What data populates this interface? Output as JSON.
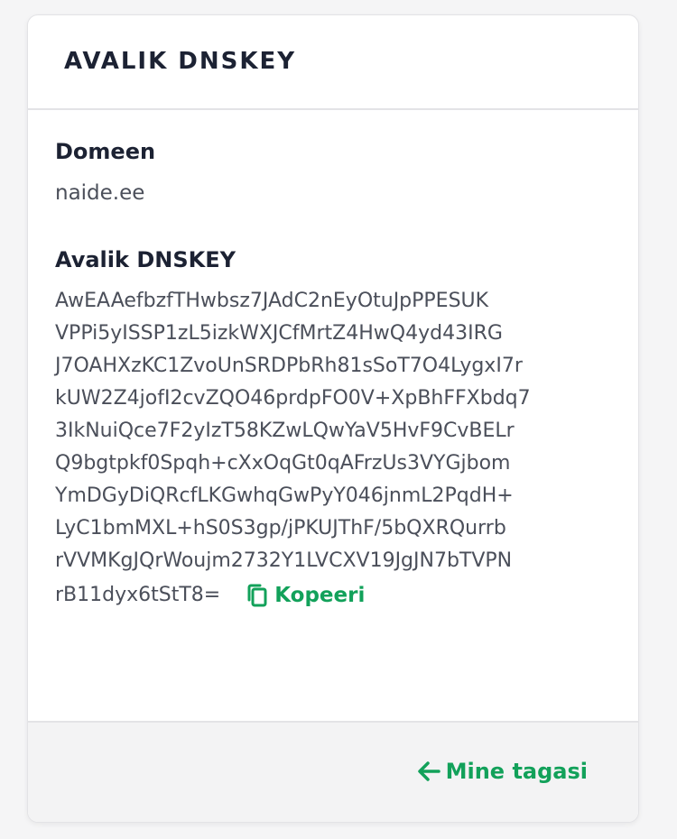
{
  "card": {
    "title": "AVALIK DNSKEY"
  },
  "domain": {
    "label": "Domeen",
    "value": "naide.ee"
  },
  "public_key": {
    "label": "Avalik DNSKEY",
    "lines": [
      "AwEAAefbzfTHwbsz7JAdC2nEyOtuJpPPESUK",
      "VPPi5yISSP1zL5izkWXJCfMrtZ4HwQ4yd43IRG",
      "J7OAHXzKC1ZvoUnSRDPbRh81sSoT7O4LygxI7r",
      "kUW2Z4jofI2cvZQO46prdpFO0V+XpBhFFXbdq7",
      "3IkNuiQce7F2yIzT58KZwLQwYaV5HvF9CvBELr",
      "Q9bgtpkf0Spqh+cXxOqGt0qAFrzUs3VYGjbom",
      "YmDGyDiQRcfLKGwhqGwPyY046jnmL2PqdH+",
      "LyC1bmMXL+hS0S3gp/jPKUJThF/5bQXRQurrb",
      "rVVMKgJQrWoujm2732Y1LVCXV19JgJN7bTVPN",
      "rB11dyx6tStT8="
    ]
  },
  "actions": {
    "copy_label": "Kopeeri",
    "back_label": "Mine tagasi"
  },
  "icons": {
    "copy": "copy-icon",
    "back": "arrow-left-icon"
  },
  "colors": {
    "accent": "#12a15a",
    "text_dark": "#1c2233",
    "text_muted": "#4b4f5a"
  }
}
